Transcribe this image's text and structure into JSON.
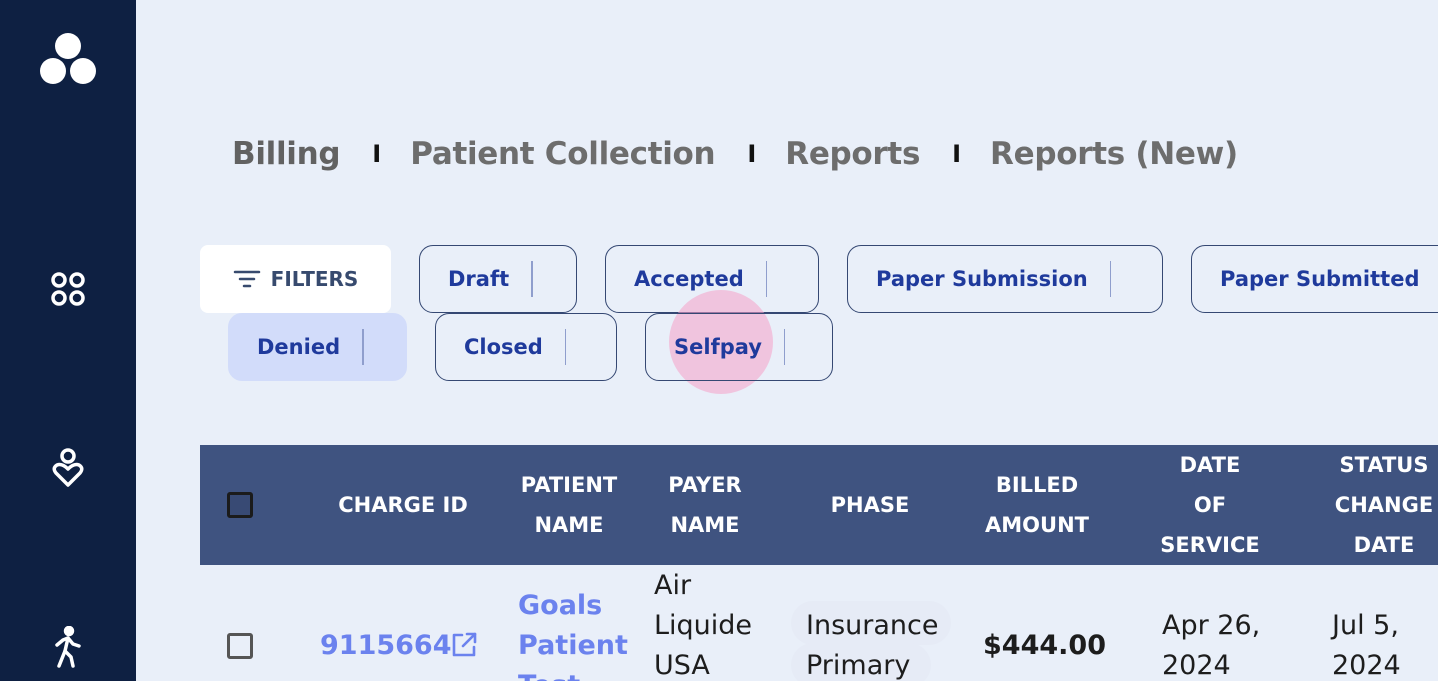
{
  "sidebar": {
    "icons": [
      "logo-icon",
      "dashboard-icon",
      "care-icon",
      "activity-icon"
    ]
  },
  "tabs": [
    {
      "label": "Billing",
      "active": true
    },
    {
      "label": "Patient Collection",
      "active": false
    },
    {
      "label": "Reports",
      "active": false
    },
    {
      "label": "Reports (New)",
      "active": false
    }
  ],
  "tab_separator": "I",
  "filters": {
    "button_label": "FILTERS",
    "chips": [
      {
        "label": "Draft",
        "active": false
      },
      {
        "label": "Accepted",
        "active": false
      },
      {
        "label": "Paper Submission",
        "active": false
      },
      {
        "label": "Paper Submitted",
        "active": false
      },
      {
        "label": "Denied",
        "active": true
      },
      {
        "label": "Closed",
        "active": false
      },
      {
        "label": "Selfpay",
        "active": false
      }
    ]
  },
  "table": {
    "columns": [
      "CHARGE ID",
      "PATIENT\nNAME",
      "PAYER\nNAME",
      "PHASE",
      "BILLED\nAMOUNT",
      "DATE\nOF\nSERVICE",
      "STATUS\nCHANGE\nDATE"
    ],
    "rows": [
      {
        "charge_id": "9115664",
        "patient_name": "Goals\nPatient\nTest",
        "payer_name": "Air\nLiquide\nUSA",
        "phase": "Insurance\nPrimary",
        "billed_amount": "$444.00",
        "date_of_service": "Apr 26,\n2024",
        "status_change_date": "Jul 5,\n2024"
      }
    ]
  },
  "colors": {
    "sidebar": "#0e2042",
    "background": "#e9eff9",
    "table_header": "#3f5380",
    "chip_text": "#1f3a9c",
    "chip_active_bg": "#d2dcfa",
    "link": "#6b82ee"
  }
}
